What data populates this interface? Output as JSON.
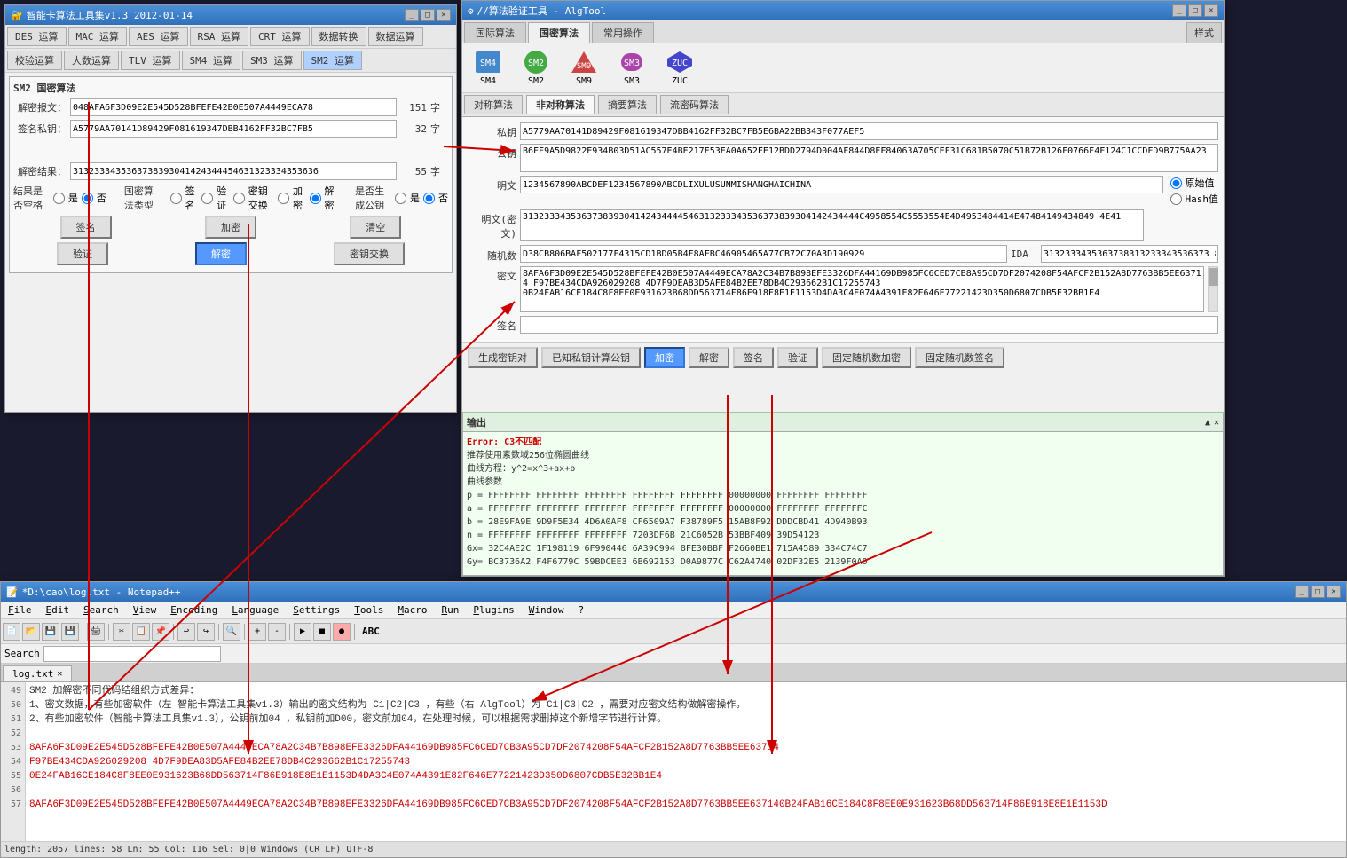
{
  "smartcard": {
    "title": "智能卡算法工具集v1.3  2012-01-14",
    "toolbar1": [
      "DES 运算",
      "MAC 运算",
      "AES 运算",
      "RSA 运算",
      "CRT 运算",
      "数据转换",
      "数据运算"
    ],
    "toolbar2": [
      "校验运算",
      "大数运算",
      "TLV 运算",
      "SM4 运算",
      "SM3 运算",
      "SM2 运算"
    ],
    "section": "SM2 国密算法",
    "cipher_label": "解密报文：",
    "cipher_value": "048AFA6F3D09E2E545D528BFEFE42B0E507A4449ECA78",
    "cipher_len": "151",
    "cipher_unit": "字",
    "privkey_label": "签名私钥：",
    "privkey_value": "A5779AA70141D89429F081619347DBB4162FF32BC7FB5",
    "privkey_len": "32",
    "privkey_unit": "字",
    "result_label": "解密结果：",
    "result_value": "3132333435363738393041424344454631323334353636",
    "result_len": "55",
    "result_unit": "字",
    "result_empty_label": "结果是否空格",
    "result_yes": "是",
    "result_no": "否",
    "algo_type_label": "国密算法类型",
    "algo_sign": "签名",
    "algo_verify": "验证",
    "algo_keyex": "密钥交换",
    "algo_enc": "加密",
    "algo_dec": "解密",
    "gen_pubkey_label": "是否生成公钥",
    "gen_yes": "是",
    "gen_no": "否",
    "btn_sign": "签名",
    "btn_enc": "加密",
    "btn_clear": "清空",
    "btn_verify": "验证",
    "btn_dec": "解密",
    "btn_keyex": "密钥交换"
  },
  "algtool": {
    "title": "//算法验证工具 - AlgTool",
    "tabs": [
      "国际算法",
      "国密算法",
      "常用操作"
    ],
    "style_label": "样式",
    "icons": [
      {
        "name": "SM4",
        "label": "SM4"
      },
      {
        "name": "SM2",
        "label": "SM2"
      },
      {
        "name": "SM9",
        "label": "SM9"
      },
      {
        "name": "SM3",
        "label": "SM3"
      },
      {
        "name": "ZUC",
        "label": "ZUC"
      }
    ],
    "subtabs": [
      "对称算法",
      "非对称算法",
      "摘要算法",
      "流密码算法"
    ],
    "privkey_label": "私钥",
    "privkey_value": "A5779AA70141D89429F081619347DBB4162FF32BC7FB5E6BA22BB343F077AEF5",
    "pubkey_label": "公钥",
    "pubkey_value": "B6FF9A5D9822E934B03D51AC557E4BE217E53EA0A652FE12BDD2794D004AF844D8EF84063A705CEF31C681B5070C51B72B126F0766F4F124C1CCDFD9B775AA23",
    "plaintext_label": "明文",
    "plaintext_value": "1234567890ABCDEF1234567890ABCDLIXULUSUNMISHANGHAICHINA",
    "plaintext_radio1": "原始值",
    "plaintext_radio2": "Hash值",
    "plaintext_enc_label": "明文(密文)",
    "plaintext_enc_value": "313233343536373839304142434444546313233343536373839304142434444C4958554C5553554E4D4953484414E47484149434849 4E41",
    "random_label": "随机数",
    "random_value": "D38CB806BAF502177F4315CD1BD05B4F8AFBC46905465A77CB72C70A3D190929",
    "ida_label": "IDA",
    "ida_value": "3132333435363738313233343536373 8",
    "ciphertext_label": "密文",
    "ciphertext_value": "8AFA6F3D09E2E545D528BFEFE42B0E507A4449ECA78A2C34B7B898EFE3326DFA44169DB985FC6CED7CB8A95CD7DF2074208F54AFCF2B152A8D7763BB5EE63714\nF97BE434CDA926029208 4D7F9DEA83D5AFE84B2EE78DB4C293662B1C17255743\n0B24FAB16CE184C8F8EE0E931623B68DD563714F86E918E8E1E1153D4DA3C4E074A4391E82F646E77221423D350D6807CDB5E32BB1E4",
    "signature_label": "签名",
    "signature_value": "",
    "action_buttons": [
      "生成密钥对",
      "已知私钥计算公钥",
      "加密",
      "解密",
      "签名",
      "验证",
      "固定随机数加密",
      "固定随机数签名"
    ],
    "active_button": "加密",
    "output": {
      "title": "输出",
      "error_text": "Error: C3不匹配",
      "lines": [
        "推荐使用素数域256位椭圆曲线",
        "曲线方程：y^2=x^3+ax+b",
        "曲线参数",
        "p = FFFFFFFF FFFFFFFF FFFFFFFF FFFFFFFF FFFFFFFF 00000000 FFFFFFFF FFFFFFFF",
        "a = FFFFFFFF FFFFFFFF FFFFFFFF FFFFFFFF FFFFFFFF 00000000 FFFFFFFF FFFFFFFC",
        "b = 28E9FA9E 9D9F5E34 4D6A0AF8 CF6509A7 F38789F5 15AB8F92 DDDCBD41 4D940B93",
        "n = FFFFFFFF FFFFFFFF FFFFFFFF 7203DF6B 21C6052B 53BBF409 39D54123",
        "Gx= 32C4AE2C 1F198119 6F990446 6A39C994 8FE30BBF F2660BE1 715A4589 334C74C7",
        "Gy= BC3736A2 F4F6779C 59BDCEE3 6B692153 D0A9877C C62A4740 02DF32E5 2139F0A0"
      ]
    }
  },
  "notepad": {
    "title": "*D:\\cao\\log.txt - Notepad++",
    "menu": [
      "File",
      "Edit",
      "Search",
      "View",
      "Encoding",
      "Language",
      "Settings",
      "Tools",
      "Macro",
      "Run",
      "Plugins",
      "Window",
      "?"
    ],
    "file_tab": "log.txt",
    "search_label": "Search",
    "lines": [
      {
        "num": "49",
        "text": "SM2 加解密不同代码结组织方式差异：",
        "style": "normal"
      },
      {
        "num": "50",
        "text": "1、密文数据，有些加密软件（左 智能卡算法工具集v1.3）输出的密文结构为 C1|C2|C3 ，有些（右 AlgTool）为 C1|C3|C2 ，需要对应密文结构做解密操作。",
        "style": "normal"
      },
      {
        "num": "51",
        "text": "2、有些加密软件（智能卡算法工具集v1.3），公钥前加04，私钥前加D0，密文前加04，在处理时候，可以根据需求删掉这个新增字节进行计算。",
        "style": "normal"
      },
      {
        "num": "52",
        "text": "",
        "style": "normal"
      },
      {
        "num": "53",
        "text": "8AFA6F3D09E2E545D528BFEFE42B0E507A4449ECA78A2C34B7B898EFE3326DFA44169DB985FC6CED7CB3A95CD7DF2074208F54AFCF2B152A8D7763BB5EE63714",
        "style": "red"
      },
      {
        "num": "54",
        "text": "F97BE434CDA926029208 4D7F9DEA83D5AFE84B2EE78DB4C293662B1C17255743",
        "style": "red"
      },
      {
        "num": "55",
        "text": "0E24FAB16CE184C8F8EE0E931623B68DD563714F86E918E8E1E1153D4DA3C4E074A4391E82F646E77221423D350D6807CDB5E32BB1E4",
        "style": "red"
      },
      {
        "num": "56",
        "text": "",
        "style": "normal"
      },
      {
        "num": "57",
        "text": "8AFA6F3D09E2E545D528BFEFE42B0E507A4449ECA78A2C34B7B898EFE3326DFA44169DB985FC6CED7CB3A95CD7DF2074208F54AFCF2B152A8D7763BB5EE637140B24FAB16CE184C8F8EE0E931623B68DD563714F86E918E8E1E1153D",
        "style": "red"
      }
    ],
    "status": "length: 2057   lines: 58   Ln: 55   Col: 116   Sel: 0|0   Windows (CR LF)   UTF-8"
  }
}
